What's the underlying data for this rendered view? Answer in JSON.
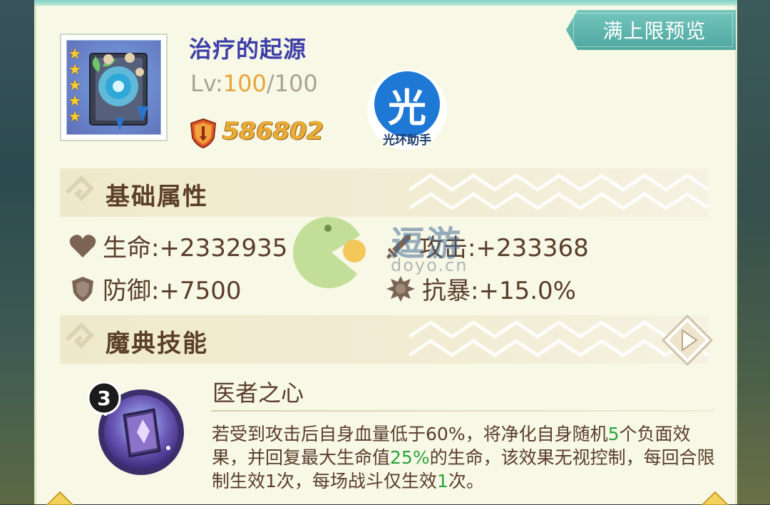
{
  "preview": {
    "label": "满上限预览"
  },
  "item": {
    "name": "治疗的起源",
    "level_prefix": "Lv:",
    "level_current": "100",
    "level_sep_max": "/100",
    "power": "586802",
    "stars": 5
  },
  "watermark": {
    "assist_label": "光环助手",
    "assist_char": "光",
    "site_name": "逗游",
    "site_url": "doyo.cn"
  },
  "basic_attrs": {
    "title": "基础属性",
    "hp": "生命:+2332935",
    "atk": "攻击:+233368",
    "def": "防御:+7500",
    "crit_resist": "抗暴:+15.0%"
  },
  "skill_section": {
    "title": "魔典技能",
    "skill": {
      "level": "3",
      "name": "医者之心",
      "desc_1": "若受到攻击后自身血量低于60%，将净化自身随机",
      "desc_num_1": "5",
      "desc_2": "个负面效果，并回复最大生命值",
      "desc_num_2": "25%",
      "desc_3": "的生命，该效果无视控制，每回合限制生效1次，每场战斗仅生效",
      "desc_num_3": "1",
      "desc_4": "次。"
    }
  },
  "colors": {
    "panel": "#f8f8e6",
    "title_blue": "#3d3fa8",
    "accent_gold": "#e7ad36",
    "text_brown": "#5a3d2b",
    "highlight_green": "#2aa33d",
    "tab_teal": "#4fa79f"
  }
}
